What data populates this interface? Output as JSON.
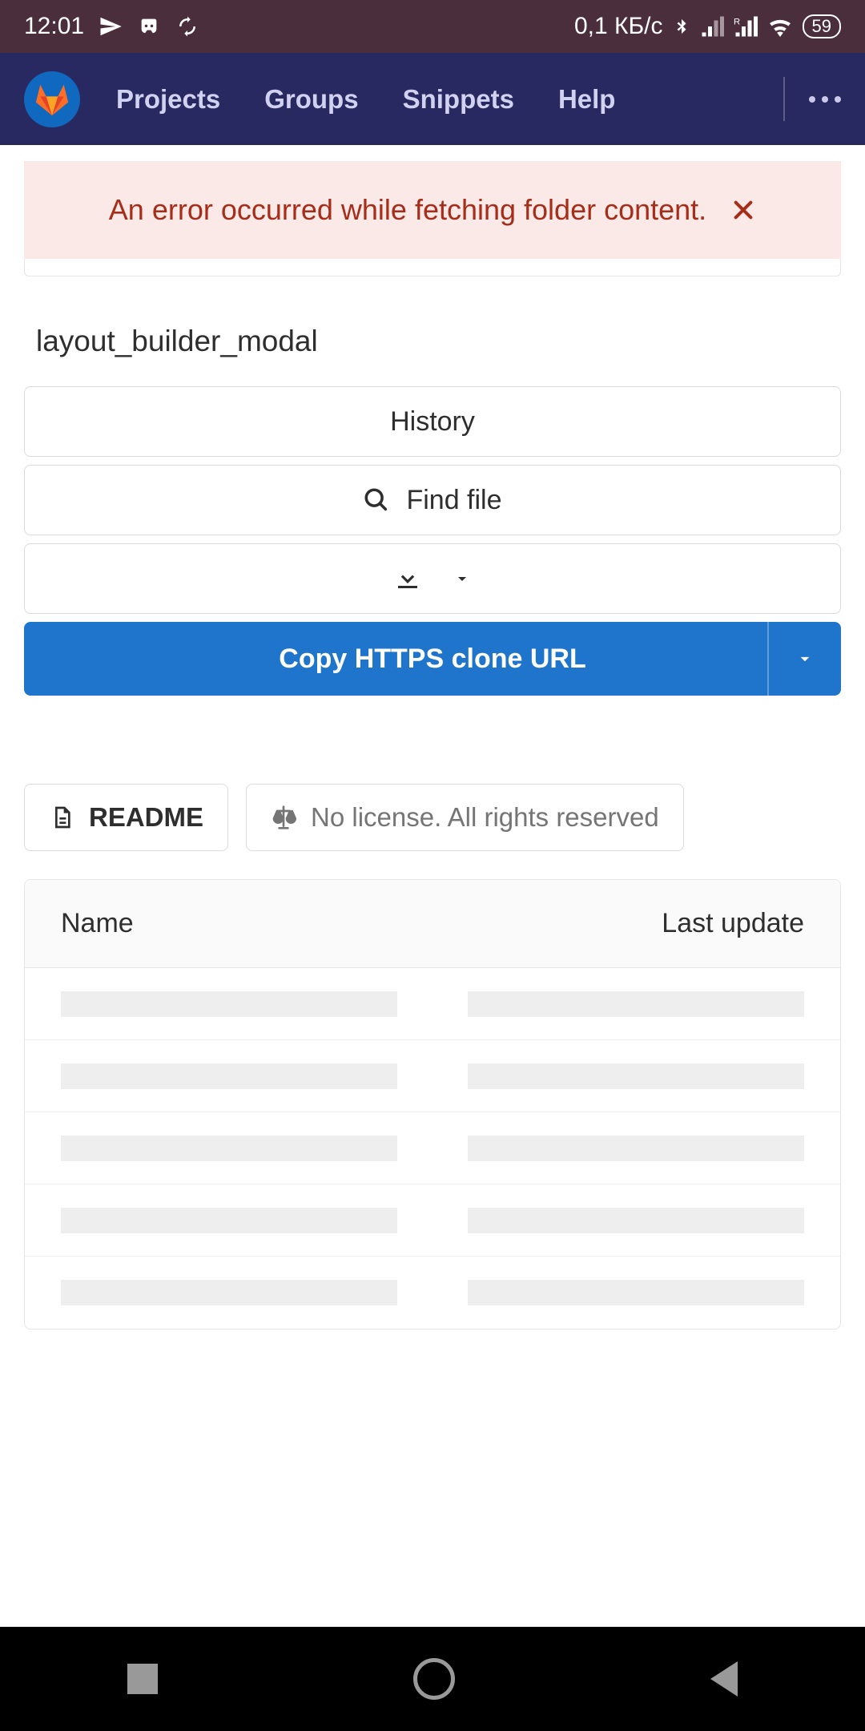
{
  "status_bar": {
    "time": "12:01",
    "data_rate": "0,1 КБ/с",
    "battery": "59"
  },
  "header": {
    "nav": {
      "projects": "Projects",
      "groups": "Groups",
      "snippets": "Snippets",
      "help": "Help"
    }
  },
  "alert": {
    "message": "An error occurred while fetching folder content."
  },
  "project": {
    "title": "layout_builder_modal"
  },
  "buttons": {
    "history": "History",
    "find_file": "Find file",
    "clone": "Copy HTTPS clone URL"
  },
  "pills": {
    "readme": "README",
    "license": "No license. All rights reserved"
  },
  "table": {
    "col_name": "Name",
    "col_updated": "Last update"
  }
}
